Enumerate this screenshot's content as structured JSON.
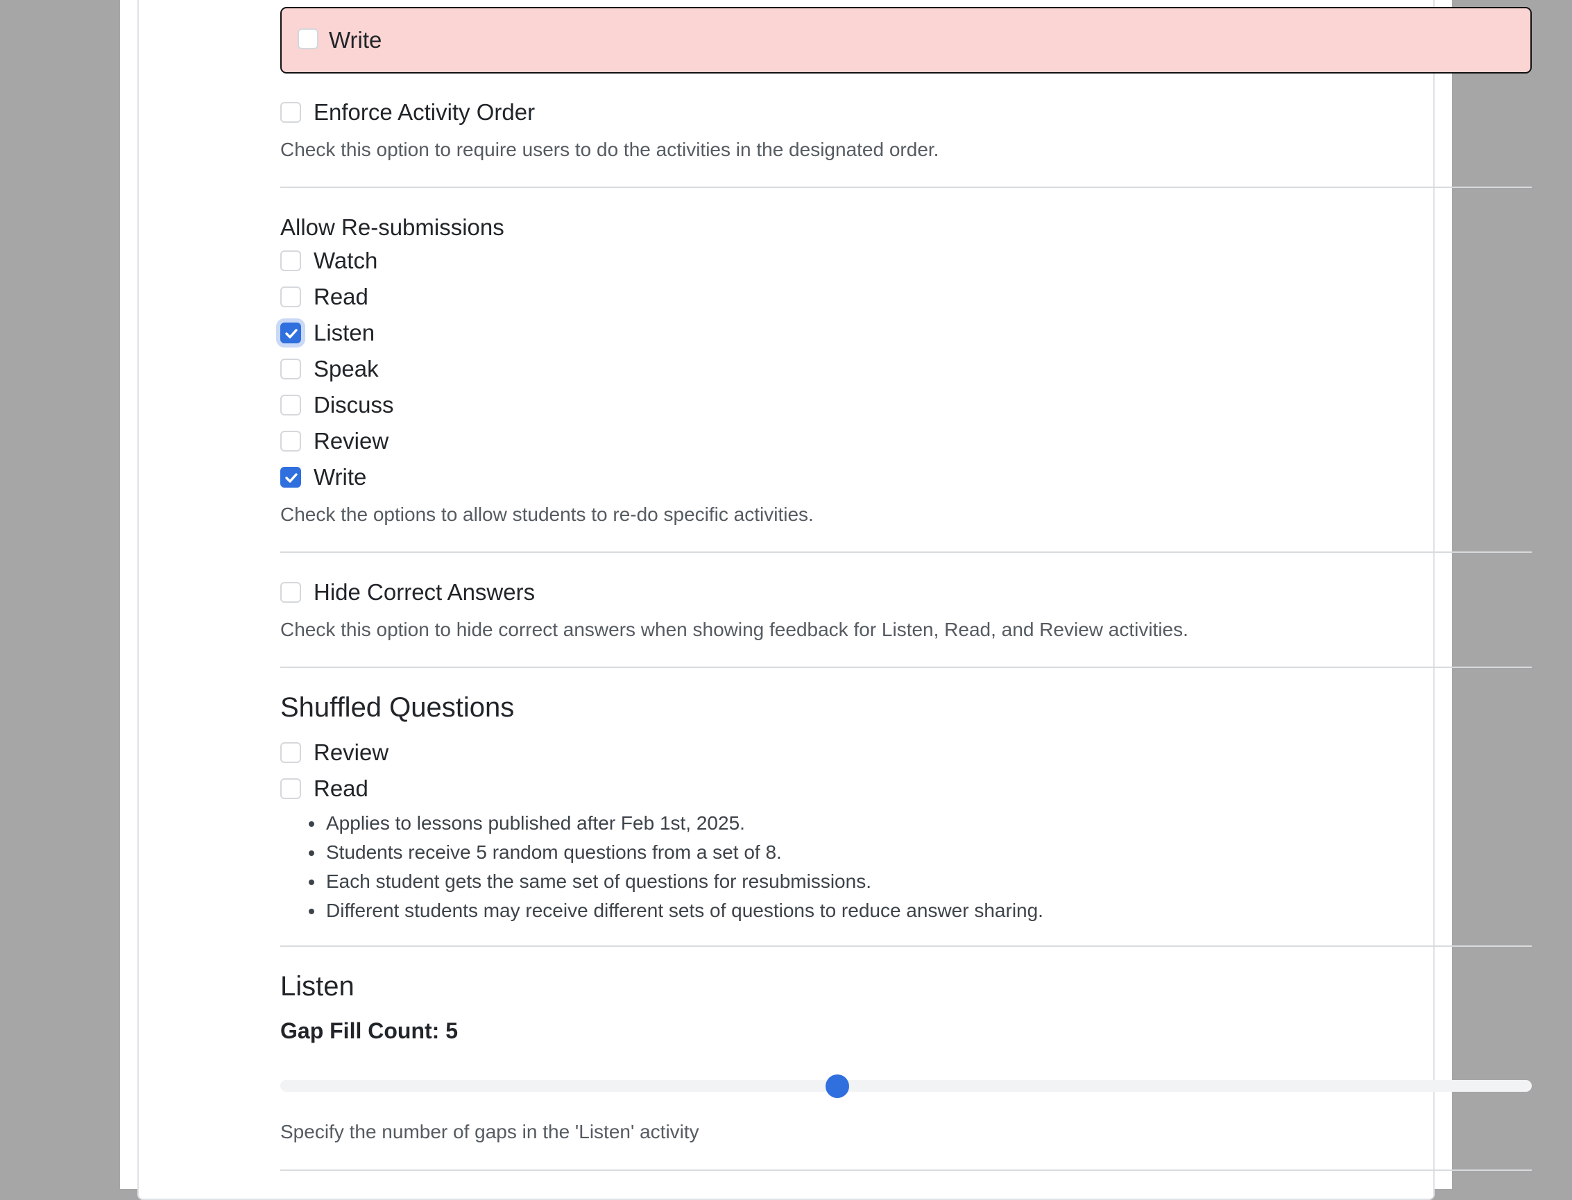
{
  "alert": {
    "label": "Write",
    "checked": false
  },
  "enforce_order": {
    "label": "Enforce Activity Order",
    "checked": false,
    "help": "Check this option to require users to do the activities in the designated order."
  },
  "resubmissions": {
    "title": "Allow Re-submissions",
    "items": [
      {
        "label": "Watch",
        "checked": false
      },
      {
        "label": "Read",
        "checked": false
      },
      {
        "label": "Listen",
        "checked": true
      },
      {
        "label": "Speak",
        "checked": false
      },
      {
        "label": "Discuss",
        "checked": false
      },
      {
        "label": "Review",
        "checked": false
      },
      {
        "label": "Write",
        "checked": true
      }
    ],
    "help": "Check the options to allow students to re-do specific activities."
  },
  "hide_answers": {
    "label": "Hide Correct Answers",
    "checked": false,
    "help": "Check this option to hide correct answers when showing feedback for Listen, Read, and Review activities."
  },
  "shuffled": {
    "title": "Shuffled Questions",
    "items": [
      {
        "label": "Review",
        "checked": false
      },
      {
        "label": "Read",
        "checked": false
      }
    ],
    "notes": [
      "Applies to lessons published after Feb 1st, 2025.",
      "Students receive 5 random questions from a set of 8.",
      "Each student gets the same set of questions for resubmissions.",
      "Different students may receive different sets of questions to reduce answer sharing."
    ]
  },
  "listen": {
    "title": "Listen",
    "gap_label": "Gap Fill Count: 5",
    "slider_fraction": 0.445,
    "help": "Specify the number of gaps in the 'Listen' activity"
  },
  "colors": {
    "accent": "#2f6fde",
    "alert_bg": "#fbd5d3"
  }
}
